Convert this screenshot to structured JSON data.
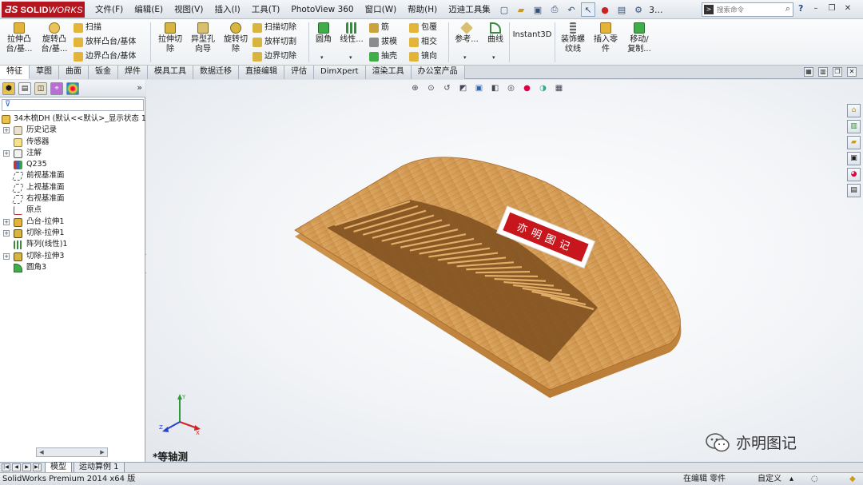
{
  "app": {
    "logo_mark": "ƋS",
    "logo_name": "SOLID",
    "logo_name2": "WORKS"
  },
  "menu": [
    "文件(F)",
    "编辑(E)",
    "视图(V)",
    "插入(I)",
    "工具(T)",
    "PhotoView 360",
    "窗口(W)",
    "帮助(H)",
    "迈迪工具集"
  ],
  "quick_icons": [
    "new-icon",
    "open-icon",
    "save-icon",
    "print-icon",
    "undo-icon",
    "select-icon",
    "traffic-light-icon",
    "file-properties-icon",
    "options-icon"
  ],
  "title_fragment": "3...",
  "search": {
    "placeholder": "搜索命令"
  },
  "command_manager": {
    "extrude_boss": "拉伸凸\n台/基...",
    "revolve_boss": "旋转凸\n台/基...",
    "sweep": "扫描",
    "loft": "放样凸台/基体",
    "boundary": "边界凸台/基体",
    "extrude_cut": "拉伸切\n除",
    "hole_wizard": "异型孔\n向导",
    "revolve_cut": "旋转切\n除",
    "swept_cut": "扫描切除",
    "lofted_cut": "放样切割",
    "boundary_cut": "边界切除",
    "fillet": "圆角",
    "linear_pattern": "线性...",
    "rib": "筋",
    "draft": "拔模",
    "shell": "抽壳",
    "wrap": "包覆",
    "intersect": "相交",
    "mirror": "镜向",
    "reference": "参考...",
    "curves": "曲线",
    "instant3d": "Instant3D",
    "cosmetic_thread": "装饰螺\n纹线",
    "insert_part": "插入零\n件",
    "move_copy": "移动/\n复制..."
  },
  "tabs": [
    "特征",
    "草图",
    "曲面",
    "钣金",
    "焊件",
    "模具工具",
    "数据迁移",
    "直接编辑",
    "评估",
    "DimXpert",
    "渲染工具",
    "办公室产品"
  ],
  "feature_tree": {
    "root": "34木梳DH  (默认<<默认>_显示状态 1",
    "items": [
      {
        "label": "历史记录",
        "icon": "history-icon",
        "expand": true
      },
      {
        "label": "传感器",
        "icon": "sensor-icon",
        "expand": false
      },
      {
        "label": "注解",
        "icon": "annotation-icon",
        "expand": true
      },
      {
        "label": "Q235",
        "icon": "material-icon",
        "expand": false
      },
      {
        "label": "前视基准面",
        "icon": "plane-icon",
        "expand": false
      },
      {
        "label": "上视基准面",
        "icon": "plane-icon",
        "expand": false
      },
      {
        "label": "右视基准面",
        "icon": "plane-icon",
        "expand": false
      },
      {
        "label": "原点",
        "icon": "origin-icon",
        "expand": false
      },
      {
        "label": "凸台-拉伸1",
        "icon": "boss-extrude-icon",
        "expand": true
      },
      {
        "label": "切除-拉伸1",
        "icon": "cut-extrude-icon",
        "expand": true
      },
      {
        "label": "阵列(线性)1",
        "icon": "linear-pattern-icon",
        "expand": false
      },
      {
        "label": "切除-拉伸3",
        "icon": "cut-extrude-icon",
        "expand": true
      },
      {
        "label": "圆角3",
        "icon": "fillet-icon",
        "expand": false
      }
    ]
  },
  "viewport": {
    "view_name": "*等轴测",
    "stamp_text": "亦明图记",
    "watermark": "亦明图记"
  },
  "bottom_tabs": [
    "模型",
    "运动算例 1"
  ],
  "status": {
    "left": "SolidWorks Premium 2014 x64 版",
    "editing": "在编辑 零件",
    "units": "自定义"
  },
  "colors": {
    "brand": "#b3161f",
    "wood": "#d7a15b",
    "stamp_red": "#c8161d"
  }
}
